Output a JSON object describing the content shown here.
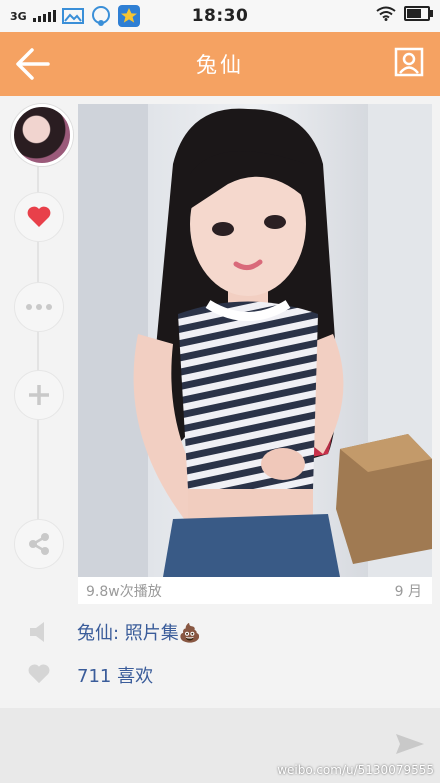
{
  "status_bar": {
    "network": "3G",
    "time": "18:30",
    "battery_level": 0.75
  },
  "header": {
    "title": "兔仙"
  },
  "post": {
    "play_count": "9.8w次播放",
    "date": "9 月",
    "caption": "兔仙: 照片集💩",
    "likes": "711 喜欢"
  },
  "icons": {
    "back": "arrow-left-icon",
    "profile": "user-card-icon",
    "like": "heart-icon",
    "more": "ellipsis-icon",
    "add": "plus-icon",
    "share": "share-icon",
    "voice": "speaker-icon",
    "likes": "heart-outline-icon",
    "send": "send-icon"
  },
  "colors": {
    "accent": "#f5a262",
    "like": "#e8404a",
    "link": "#3a5c9a"
  },
  "watermark": "weibo.com/u/5130079555"
}
